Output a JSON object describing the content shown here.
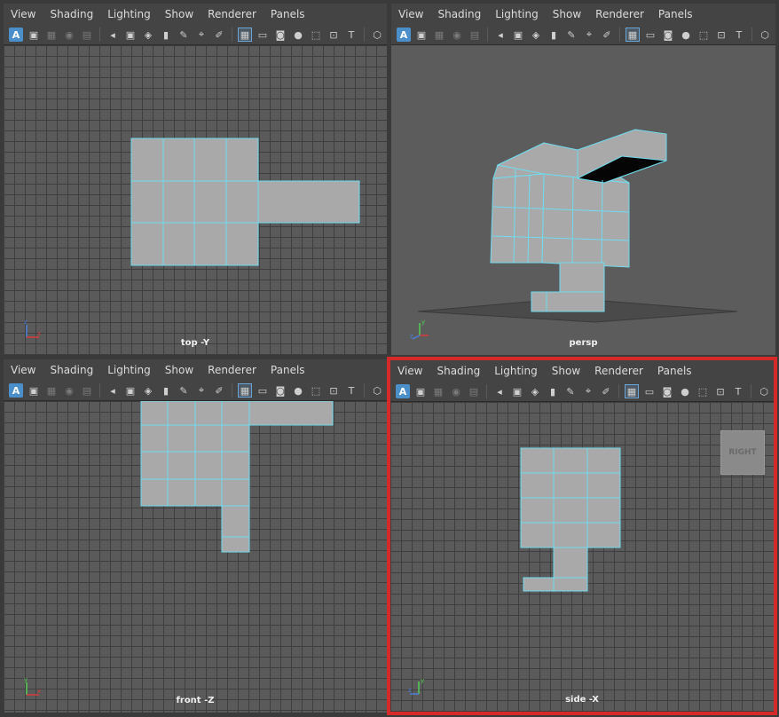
{
  "menu": [
    "View",
    "Shading",
    "Lighting",
    "Show",
    "Renderer",
    "Panels"
  ],
  "toolbar_icons": [
    "select-camera-icon",
    "camera-icon",
    "bookmark-icon",
    "grid-icon",
    "film-gate-icon",
    "resolution-gate-icon",
    "texture-icon",
    "xray-icon",
    "text-icon",
    "cube-icon"
  ],
  "panels": {
    "top": {
      "label": "top -Y"
    },
    "persp": {
      "label": "persp"
    },
    "front": {
      "label": "front -Z"
    },
    "side": {
      "label": "side -X",
      "view_cube": "RIGHT"
    }
  },
  "colors": {
    "active_border": "#d42a2a",
    "wireframe": "#6fdcf0",
    "mesh_fill": "#a9a9a9",
    "axis_x": "#d83a3a",
    "axis_y": "#55cc55",
    "axis_z": "#4a7fd8"
  }
}
